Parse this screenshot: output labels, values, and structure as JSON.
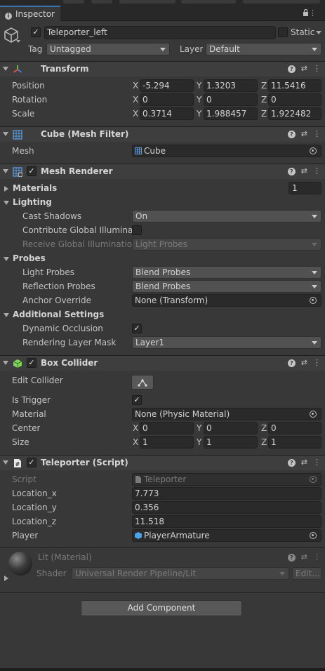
{
  "tab": {
    "label": "Inspector"
  },
  "object": {
    "name": "Teleporter_left",
    "active": true,
    "static_label": "Static",
    "tag_label": "Tag",
    "tag_value": "Untagged",
    "layer_label": "Layer",
    "layer_value": "Default"
  },
  "transform": {
    "title": "Transform",
    "position_label": "Position",
    "rotation_label": "Rotation",
    "scale_label": "Scale",
    "x": "X",
    "y": "Y",
    "z": "Z",
    "position": [
      "-5.294",
      "1.3203",
      "11.5416"
    ],
    "rotation": [
      "0",
      "0",
      "0"
    ],
    "scale": [
      "0.3714",
      "1.988457",
      "1.922482"
    ]
  },
  "mesh_filter": {
    "title": "Cube (Mesh Filter)",
    "mesh_label": "Mesh",
    "mesh_value": "Cube"
  },
  "mesh_renderer": {
    "title": "Mesh Renderer",
    "materials_label": "Materials",
    "materials_count": "1",
    "lighting_label": "Lighting",
    "cast_shadows_label": "Cast Shadows",
    "cast_shadows_value": "On",
    "contribute_gi_label": "Contribute Global Illuminatic",
    "receive_gi_label": "Receive Global Illumination",
    "receive_gi_value": "Light Probes",
    "probes_label": "Probes",
    "light_probes_label": "Light Probes",
    "light_probes_value": "Blend Probes",
    "reflection_probes_label": "Reflection Probes",
    "reflection_probes_value": "Blend Probes",
    "anchor_override_label": "Anchor Override",
    "anchor_override_value": "None (Transform)",
    "additional_settings_label": "Additional Settings",
    "dynamic_occlusion_label": "Dynamic Occlusion",
    "rendering_layer_mask_label": "Rendering Layer Mask",
    "rendering_layer_mask_value": "Layer1"
  },
  "box_collider": {
    "title": "Box Collider",
    "edit_collider_label": "Edit Collider",
    "is_trigger_label": "Is Trigger",
    "material_label": "Material",
    "material_value": "None (Physic Material)",
    "center_label": "Center",
    "size_label": "Size",
    "center": [
      "0",
      "0",
      "0"
    ],
    "size": [
      "1",
      "1",
      "1"
    ]
  },
  "script": {
    "title": "Teleporter (Script)",
    "script_label": "Script",
    "script_value": "Teleporter",
    "location_x_label": "Location_x",
    "location_x_value": "7.773",
    "location_y_label": "Location_y",
    "location_y_value": "0.356",
    "location_z_label": "Location_z",
    "location_z_value": "11.518",
    "player_label": "Player",
    "player_value": "PlayerArmature"
  },
  "material": {
    "title": "Lit (Material)",
    "shader_label": "Shader",
    "shader_value": "Universal Render Pipeline/Lit",
    "edit_label": "Edit..."
  },
  "add_component": {
    "label": "Add Component"
  },
  "colors": {
    "accent": "#3a72b0",
    "background": "#383838",
    "header": "#3e3e3e",
    "field": "#2a2a2a"
  }
}
